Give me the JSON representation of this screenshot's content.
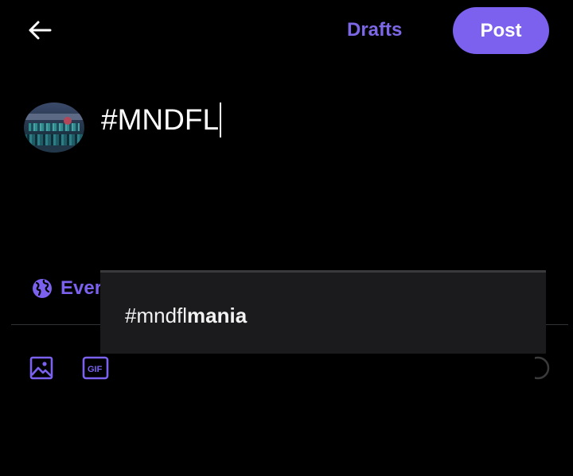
{
  "header": {
    "back_icon": "arrow-left-icon",
    "drafts_label": "Drafts",
    "post_label": "Post"
  },
  "composer": {
    "avatar": "user-avatar",
    "text": "#MNDFL"
  },
  "audience": {
    "icon": "globe-icon",
    "label": "Everyone"
  },
  "toolbar": {
    "items": [
      "image-icon",
      "gif-icon"
    ]
  },
  "suggestions": [
    {
      "prefix": "#mndfl",
      "rest": "mania"
    }
  ],
  "colors": {
    "accent": "#7b61ee",
    "background": "#000000",
    "popup_bg": "#1b1b1d"
  }
}
